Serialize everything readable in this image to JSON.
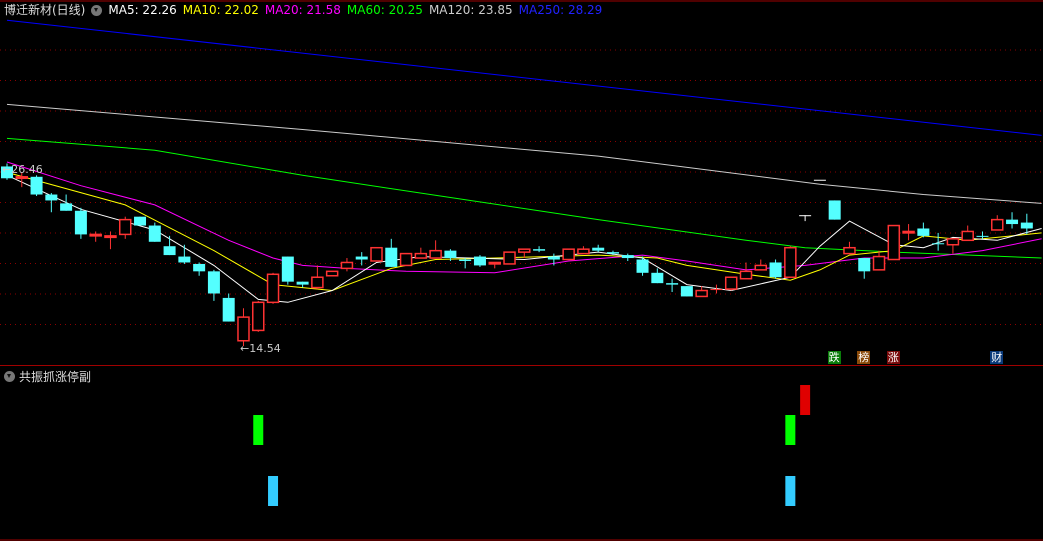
{
  "header": {
    "title": "博迁新材(日线)",
    "ma": [
      {
        "label": "MA5: 22.26",
        "color": "#ffffff"
      },
      {
        "label": "MA10: 22.02",
        "color": "#ffff00"
      },
      {
        "label": "MA20: 21.58",
        "color": "#ff00ff"
      },
      {
        "label": "MA60: 20.25",
        "color": "#00ff00"
      },
      {
        "label": "MA120: 23.85",
        "color": "#cccccc"
      },
      {
        "label": "MA250: 28.29",
        "color": "#0000ff"
      }
    ]
  },
  "sub_panel": {
    "title": "共振抓涨停副"
  },
  "markers": [
    {
      "text": "跌",
      "index": 56,
      "color": "#0a7d0a"
    },
    {
      "text": "榜",
      "index": 58,
      "color": "#8a4a0a"
    },
    {
      "text": "涨",
      "index": 60,
      "color": "#7a0a0a"
    },
    {
      "text": "财",
      "index": 67,
      "color": "#0a3a7a"
    }
  ],
  "colors": {
    "up": "#ff3333",
    "down": "#54ffff",
    "flat": "#ffffff",
    "grid": "#8b0000",
    "separator": "#a00000"
  },
  "chart_data": {
    "type": "candlestick",
    "high_label": "26.46",
    "low_label": "14.54",
    "ohlc": [
      [
        26.7,
        25.9,
        26.9,
        25.8
      ],
      [
        25.9,
        26.0,
        26.3,
        25.3
      ],
      [
        26.0,
        24.8,
        26.1,
        24.7
      ],
      [
        24.8,
        24.4,
        24.9,
        23.6
      ],
      [
        24.2,
        23.7,
        24.8,
        23.7
      ],
      [
        23.7,
        22.1,
        23.9,
        21.8
      ],
      [
        22.0,
        22.1,
        22.3,
        21.6
      ],
      [
        21.9,
        22.0,
        22.3,
        21.1
      ],
      [
        22.1,
        23.1,
        23.3,
        21.8
      ],
      [
        23.3,
        22.7,
        23.3,
        22.7
      ],
      [
        22.7,
        21.6,
        22.9,
        21.6
      ],
      [
        21.3,
        20.7,
        22.0,
        20.7
      ],
      [
        20.6,
        20.2,
        21.4,
        20.1
      ],
      [
        20.1,
        19.6,
        20.2,
        19.3
      ],
      [
        19.6,
        18.1,
        19.7,
        17.6
      ],
      [
        17.8,
        16.2,
        18.1,
        16.2
      ],
      [
        14.9,
        16.5,
        17.1,
        14.54
      ],
      [
        15.6,
        17.5,
        17.6,
        15.5
      ],
      [
        17.5,
        19.4,
        19.5,
        17.4
      ],
      [
        20.6,
        18.9,
        20.6,
        18.7
      ],
      [
        18.9,
        18.7,
        18.9,
        18.5
      ],
      [
        18.5,
        19.2,
        20.0,
        18.4
      ],
      [
        19.3,
        19.6,
        19.6,
        19.3
      ],
      [
        19.8,
        20.2,
        20.5,
        19.6
      ],
      [
        20.6,
        20.4,
        20.9,
        20.0
      ],
      [
        20.3,
        21.2,
        21.2,
        20.3
      ],
      [
        21.2,
        19.9,
        21.8,
        19.9
      ],
      [
        20.0,
        20.8,
        20.8,
        20.0
      ],
      [
        20.5,
        20.8,
        21.2,
        20.5
      ],
      [
        20.5,
        21.0,
        21.7,
        20.5
      ],
      [
        21.0,
        20.5,
        21.1,
        20.3
      ],
      [
        20.4,
        20.3,
        20.5,
        19.8
      ],
      [
        20.6,
        20.0,
        20.7,
        19.9
      ],
      [
        20.1,
        20.2,
        20.2,
        19.8
      ],
      [
        20.1,
        20.9,
        20.9,
        20.1
      ],
      [
        20.9,
        21.1,
        21.1,
        20.5
      ],
      [
        21.1,
        21.0,
        21.3,
        20.9
      ],
      [
        20.6,
        20.4,
        20.8,
        20.0
      ],
      [
        20.4,
        21.1,
        21.1,
        20.4
      ],
      [
        20.8,
        21.1,
        21.3,
        20.8
      ],
      [
        21.2,
        21.0,
        21.4,
        20.9
      ],
      [
        20.9,
        20.8,
        21.0,
        20.7
      ],
      [
        20.7,
        20.5,
        20.8,
        20.3
      ],
      [
        20.4,
        19.5,
        20.6,
        19.3
      ],
      [
        19.5,
        18.8,
        19.8,
        18.8
      ],
      [
        18.8,
        18.7,
        19.1,
        18.2
      ],
      [
        18.6,
        17.9,
        18.6,
        17.9
      ],
      [
        17.9,
        18.3,
        18.6,
        17.9
      ],
      [
        18.4,
        18.4,
        18.7,
        18.1
      ],
      [
        18.4,
        19.2,
        19.2,
        18.3
      ],
      [
        19.1,
        19.6,
        20.2,
        19.1
      ],
      [
        19.7,
        20.0,
        20.4,
        19.7
      ],
      [
        20.2,
        19.2,
        20.4,
        19.1
      ],
      [
        19.2,
        21.2,
        21.3,
        19.2
      ],
      [
        23.4,
        23.4,
        23.4,
        23.0
      ],
      [
        25.8,
        25.8,
        25.8,
        25.8
      ],
      [
        24.4,
        23.1,
        24.4,
        23.1
      ],
      [
        20.8,
        21.2,
        21.6,
        20.8
      ],
      [
        20.5,
        19.6,
        20.5,
        19.1
      ],
      [
        19.7,
        20.6,
        21.0,
        19.7
      ],
      [
        20.4,
        22.7,
        22.7,
        20.4
      ],
      [
        22.2,
        22.3,
        22.8,
        21.7
      ],
      [
        22.5,
        22.0,
        22.9,
        21.9
      ],
      [
        21.5,
        21.5,
        22.2,
        21.0
      ],
      [
        21.4,
        21.8,
        21.8,
        20.8
      ],
      [
        21.7,
        22.3,
        22.7,
        21.7
      ],
      [
        22.0,
        22.0,
        22.3,
        21.8
      ],
      [
        22.4,
        23.1,
        23.4,
        22.4
      ],
      [
        23.1,
        22.8,
        23.6,
        22.5
      ],
      [
        22.9,
        22.5,
        23.5,
        22.1
      ]
    ],
    "ma_series": [
      {
        "name": "MA250",
        "color": "#0000ff",
        "points": [
          [
            0,
            36.6
          ],
          [
            70,
            28.8
          ]
        ]
      },
      {
        "name": "MA120",
        "color": "#cccccc",
        "points": [
          [
            0,
            30.9
          ],
          [
            20,
            29.2
          ],
          [
            40,
            27.4
          ],
          [
            55,
            25.5
          ],
          [
            62,
            24.8
          ],
          [
            70,
            24.2
          ]
        ]
      },
      {
        "name": "MA60",
        "color": "#00ff00",
        "points": [
          [
            0,
            28.6
          ],
          [
            10,
            27.8
          ],
          [
            20,
            26.1
          ],
          [
            30,
            24.6
          ],
          [
            40,
            23.1
          ],
          [
            50,
            21.7
          ],
          [
            54,
            21.2
          ],
          [
            60,
            20.9
          ],
          [
            70,
            20.5
          ]
        ]
      },
      {
        "name": "MA20",
        "color": "#ff00ff",
        "points": [
          [
            0,
            27.0
          ],
          [
            5,
            25.4
          ],
          [
            10,
            24.1
          ],
          [
            15,
            21.7
          ],
          [
            18,
            20.5
          ],
          [
            20,
            20.0
          ],
          [
            23,
            19.8
          ],
          [
            27,
            19.6
          ],
          [
            33,
            19.5
          ],
          [
            38,
            20.3
          ],
          [
            43,
            20.7
          ],
          [
            46,
            20.3
          ],
          [
            50,
            19.7
          ],
          [
            54,
            20.0
          ],
          [
            58,
            20.5
          ],
          [
            62,
            20.5
          ],
          [
            66,
            21.0
          ],
          [
            70,
            21.8
          ]
        ]
      },
      {
        "name": "MA10",
        "color": "#ffff00",
        "points": [
          [
            0,
            26.3
          ],
          [
            8,
            24.1
          ],
          [
            14,
            21.0
          ],
          [
            18,
            18.7
          ],
          [
            20,
            18.5
          ],
          [
            22,
            18.3
          ],
          [
            26,
            19.8
          ],
          [
            29,
            20.4
          ],
          [
            33,
            20.5
          ],
          [
            40,
            20.7
          ],
          [
            44,
            20.5
          ],
          [
            46,
            20.0
          ],
          [
            50,
            19.4
          ],
          [
            53,
            19.0
          ],
          [
            55,
            19.7
          ],
          [
            57,
            20.7
          ],
          [
            60,
            21.0
          ],
          [
            62,
            22.0
          ],
          [
            65,
            21.7
          ],
          [
            70,
            22.2
          ]
        ]
      },
      {
        "name": "MA5",
        "color": "#ffffff",
        "points": [
          [
            0,
            26.1
          ],
          [
            5,
            23.8
          ],
          [
            10,
            22.4
          ],
          [
            14,
            20.0
          ],
          [
            17,
            17.7
          ],
          [
            19,
            17.5
          ],
          [
            22,
            18.3
          ],
          [
            25,
            20.2
          ],
          [
            28,
            20.6
          ],
          [
            35,
            20.4
          ],
          [
            40,
            20.9
          ],
          [
            43,
            20.5
          ],
          [
            46,
            18.7
          ],
          [
            49,
            18.3
          ],
          [
            53,
            19.2
          ],
          [
            55,
            21.3
          ],
          [
            57,
            23.0
          ],
          [
            60,
            21.4
          ],
          [
            62,
            21.2
          ],
          [
            64,
            21.9
          ],
          [
            67,
            21.7
          ],
          [
            70,
            22.5
          ]
        ]
      }
    ],
    "signals": [
      {
        "index": 17,
        "row": "middle",
        "color": "#00ff00"
      },
      {
        "index": 53,
        "row": "middle",
        "color": "#00ff00"
      },
      {
        "index": 54,
        "row": "top",
        "color": "#e00000"
      },
      {
        "index": 18,
        "row": "bottom",
        "color": "#33ccff"
      },
      {
        "index": 53,
        "row": "bottom",
        "color": "#33ccff"
      }
    ]
  }
}
